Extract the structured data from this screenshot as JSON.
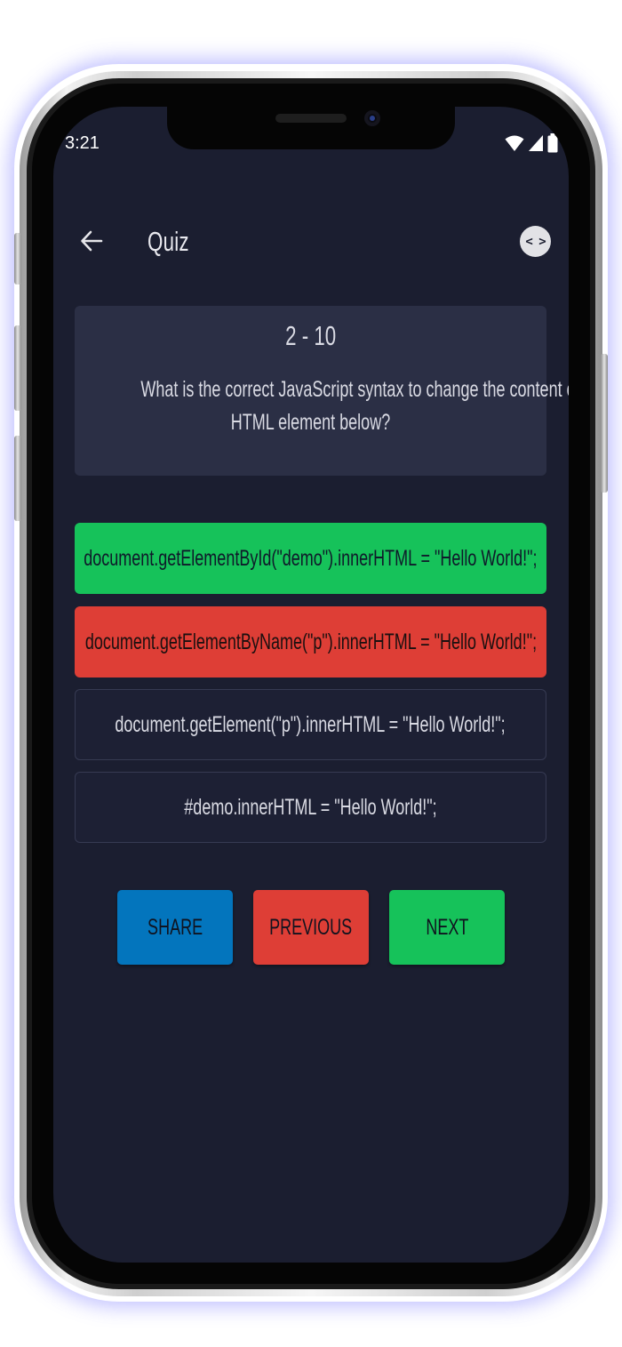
{
  "status_bar": {
    "time": "3:21",
    "icons": [
      "wifi-icon",
      "signal-icon",
      "battery-icon"
    ]
  },
  "app_bar": {
    "title": "Quiz",
    "back_icon": "arrow-left-icon",
    "code_icon_label": "< >"
  },
  "question": {
    "progress": "2 - 10",
    "text_lines": [
      "What is the correct JavaScript syntax to change the content of the",
      "HTML element below?"
    ]
  },
  "options": [
    {
      "text": "document.getElementById(\"demo\").innerHTML = \"Hello World!\";",
      "state": "correct"
    },
    {
      "text": "document.getElementByName(\"p\").innerHTML = \"Hello World!\";",
      "state": "wrong"
    },
    {
      "text": "document.getElement(\"p\").innerHTML = \"Hello World!\";",
      "state": "neutral"
    },
    {
      "text": "#demo.innerHTML = \"Hello World!\";",
      "state": "neutral"
    }
  ],
  "actions": {
    "share_label": "SHARE",
    "previous_label": "PREVIOUS",
    "next_label": "NEXT"
  },
  "colors": {
    "background": "#1b1e30",
    "card": "#2b2f45",
    "correct": "#16c25a",
    "wrong": "#de3e36",
    "share": "#0375bd",
    "previous": "#de3e36",
    "next": "#16c25a"
  }
}
